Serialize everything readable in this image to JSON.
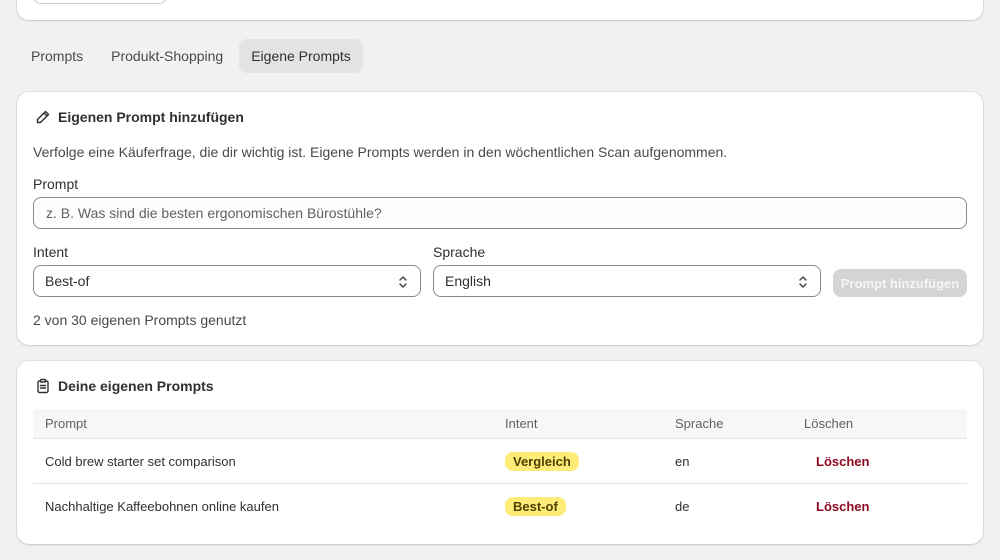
{
  "tabs": [
    {
      "label": "Prompts",
      "active": false
    },
    {
      "label": "Produkt-Shopping",
      "active": false
    },
    {
      "label": "Eigene Prompts",
      "active": true
    }
  ],
  "add_card": {
    "title": "Eigenen Prompt hinzufügen",
    "title_icon": "pencil-icon",
    "description": "Verfolge eine Käuferfrage, die dir wichtig ist. Eigene Prompts werden in den wöchentlichen Scan aufgenommen.",
    "prompt_label": "Prompt",
    "prompt_value": "",
    "prompt_placeholder": "z. B. Was sind die besten ergonomischen Bürostühle?",
    "intent_label": "Intent",
    "intent_value": "Best-of",
    "language_label": "Sprache",
    "language_value": "English",
    "submit_label": "Prompt hinzufügen",
    "usage_text": "2 von 30 eigenen Prompts genutzt"
  },
  "list_card": {
    "title": "Deine eigenen Prompts",
    "title_icon": "clipboard-icon",
    "columns": [
      "Prompt",
      "Intent",
      "Sprache",
      "Löschen"
    ],
    "rows": [
      {
        "prompt": "Cold brew starter set comparison",
        "intent": "Vergleich",
        "language": "en",
        "action": "Löschen"
      },
      {
        "prompt": "Nachhaltige Kaffeebohnen online kaufen",
        "intent": "Best-of",
        "language": "de",
        "action": "Löschen"
      }
    ]
  },
  "colors": {
    "badge_bg": "#ffeb78",
    "delete_text": "#8e0b21",
    "disabled_button": "#d4d4d4"
  }
}
